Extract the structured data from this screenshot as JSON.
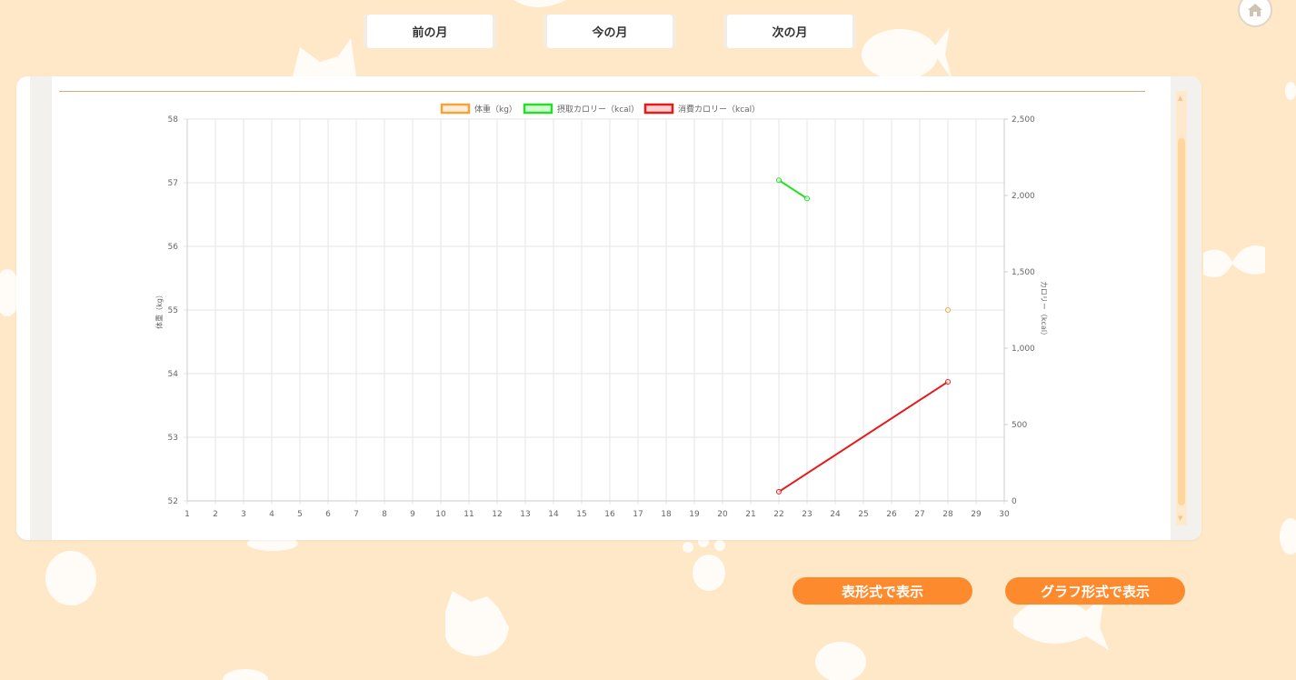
{
  "nav": {
    "prev_month": "前の月",
    "this_month": "今の月",
    "next_month": "次の月",
    "home_icon": "home-icon"
  },
  "view_buttons": {
    "table": "表形式で表示",
    "graph": "グラフ形式で表示"
  },
  "colors": {
    "background": "#ffe8c8",
    "accent": "#fd8a2c",
    "weight": "#f5a43a",
    "intake": "#22e022",
    "burn": "#e8191b"
  },
  "chart_data": {
    "type": "line",
    "title": "",
    "xlabel": "",
    "ylabel_left": "体重（kg）",
    "ylabel_right": "カロリー（kcal）",
    "x": [
      1,
      2,
      3,
      4,
      5,
      6,
      7,
      8,
      9,
      10,
      11,
      12,
      13,
      14,
      15,
      16,
      17,
      18,
      19,
      20,
      21,
      22,
      23,
      24,
      25,
      26,
      27,
      28,
      29,
      30
    ],
    "xlim": [
      1,
      30
    ],
    "ylim_left": [
      52,
      58
    ],
    "yticks_left": [
      "52",
      "53",
      "54",
      "55",
      "56",
      "57",
      "58"
    ],
    "ylim_right": [
      0,
      2500
    ],
    "yticks_right": [
      "0",
      "500",
      "1,000",
      "1,500",
      "2,000",
      "2,500"
    ],
    "grid": true,
    "legend_position": "top-center",
    "series": [
      {
        "name": "体重（kg）",
        "axis": "left",
        "color": "#f5a43a",
        "x": [
          28
        ],
        "y": [
          55
        ]
      },
      {
        "name": "摂取カロリー（kcal）",
        "axis": "right",
        "color": "#22e022",
        "x": [
          22,
          23
        ],
        "y": [
          2100,
          1980
        ]
      },
      {
        "name": "消費カロリー（kcal）",
        "axis": "right",
        "color": "#e8191b",
        "x": [
          22,
          28
        ],
        "y": [
          60,
          780
        ]
      }
    ]
  }
}
